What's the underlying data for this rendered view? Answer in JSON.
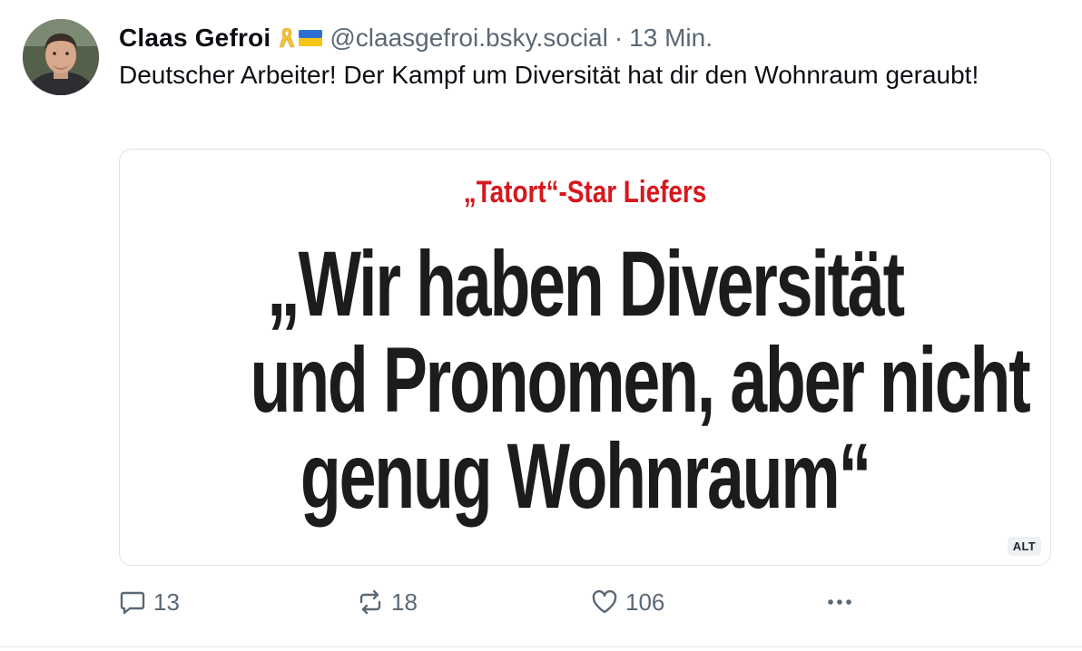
{
  "author": {
    "name": "Claas Gefroi",
    "badges": [
      "yellow-ribbon-icon",
      "ukraine-flag-icon"
    ],
    "handle": "@claasgefroi.bsky.social",
    "separator": "·",
    "time": "13 Min."
  },
  "post": {
    "text": "Deutscher Arbeiter! Der Kampf um Diversität hat dir den Wohnraum geraubt!"
  },
  "embed": {
    "kicker": "„Tatort“-Star Liefers",
    "headline_lines": [
      "„Wir haben Diversität",
      "und Pronomen, aber nicht",
      "genug Wohnraum“"
    ],
    "alt_label": "ALT"
  },
  "actions": {
    "reply_count": "13",
    "repost_count": "18",
    "like_count": "106"
  },
  "colors": {
    "kicker_red": "#d6181e",
    "muted": "#5b6876",
    "text": "#0b0f14"
  }
}
